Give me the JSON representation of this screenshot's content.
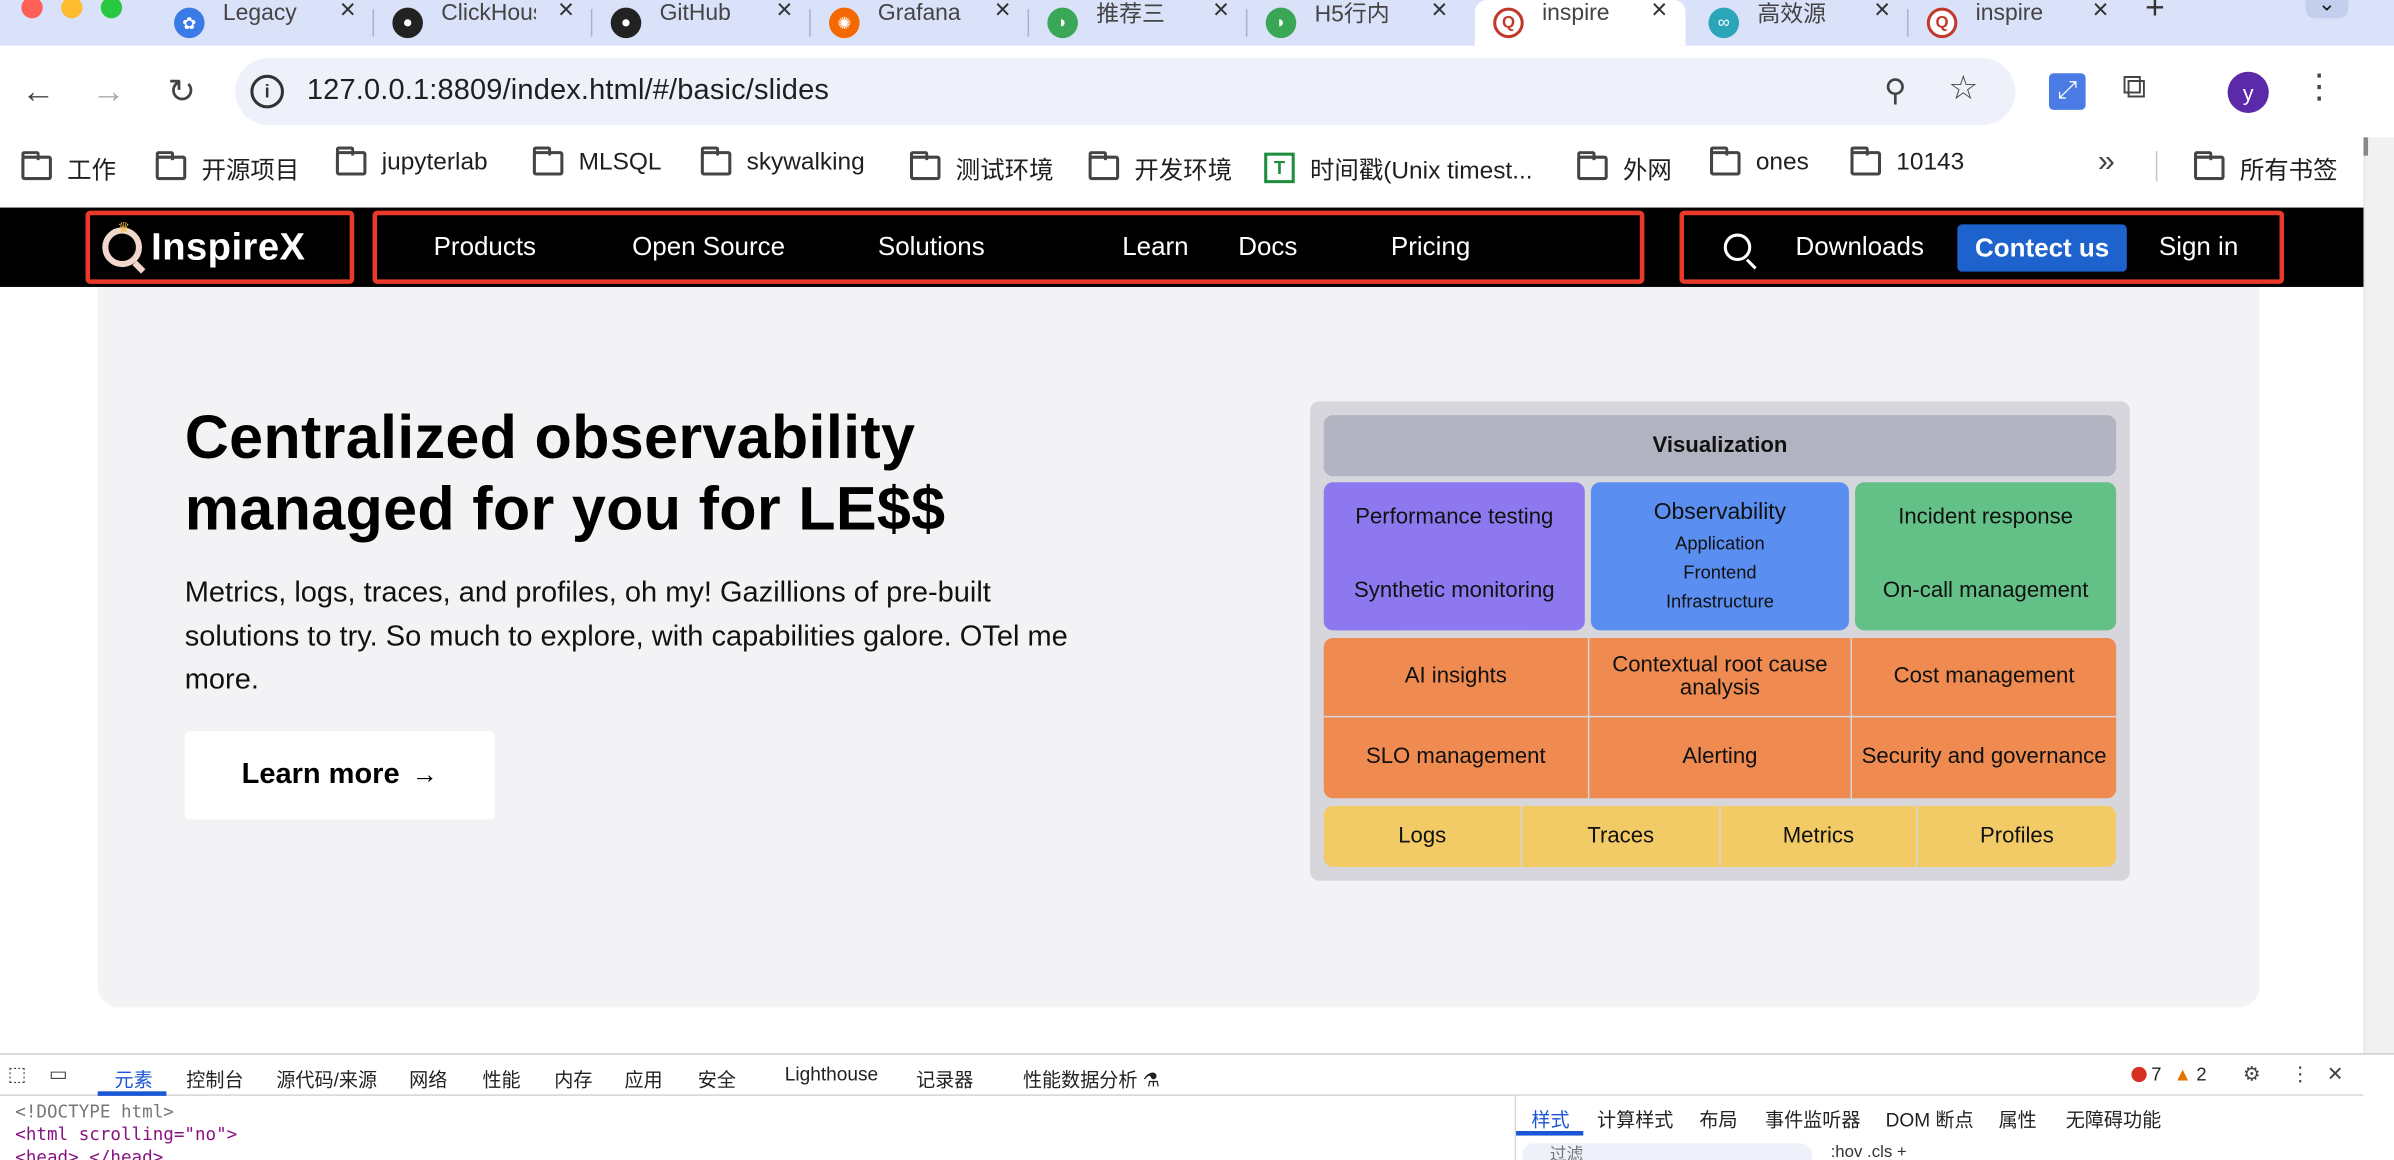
{
  "browser": {
    "tabs": [
      {
        "title": "Legacy",
        "favicon": "legacy-icon",
        "color": "#3b7be5",
        "active": false
      },
      {
        "title": "ClickHouse",
        "favicon": "github-icon",
        "color": "#222222",
        "active": false
      },
      {
        "title": "GitHub",
        "favicon": "github-icon",
        "color": "#222222",
        "active": false
      },
      {
        "title": "Grafana",
        "favicon": "grafana-icon",
        "color": "#f46800",
        "active": false
      },
      {
        "title": "推荐三",
        "favicon": "leaf-icon",
        "color": "#3aa757",
        "active": false
      },
      {
        "title": "H5行内",
        "favicon": "leaf-icon",
        "color": "#3aa757",
        "active": false
      },
      {
        "title": "inspire",
        "favicon": "inspirex-icon",
        "color": "#c0392b",
        "active": true
      },
      {
        "title": "高效源",
        "favicon": "link-icon",
        "color": "#2aa6b8",
        "active": false
      },
      {
        "title": "inspire",
        "favicon": "inspirex-icon",
        "color": "#c0392b",
        "active": false
      }
    ],
    "url": "127.0.0.1:8809/index.html/#/basic/slides",
    "profile_initial": "y",
    "bookmarks": [
      {
        "label": "工作",
        "icon": "folder-icon"
      },
      {
        "label": "开源项目",
        "icon": "folder-icon"
      },
      {
        "label": "jupyterlab",
        "icon": "folder-icon"
      },
      {
        "label": "MLSQL",
        "icon": "folder-icon"
      },
      {
        "label": "skywalking",
        "icon": "folder-icon"
      },
      {
        "label": "测试环境",
        "icon": "folder-icon"
      },
      {
        "label": "开发环境",
        "icon": "folder-icon"
      },
      {
        "label": "时间戳(Unix timest...",
        "icon": "sheet-icon"
      },
      {
        "label": "外网",
        "icon": "folder-icon"
      },
      {
        "label": "ones",
        "icon": "folder-icon"
      },
      {
        "label": "10143",
        "icon": "folder-icon"
      }
    ],
    "bookmarks_more": "»",
    "all_bookmarks": "所有书签"
  },
  "site": {
    "brand": "InspireX",
    "nav": [
      "Products",
      "Open Source",
      "Solutions",
      "Learn",
      "Docs",
      "Pricing"
    ],
    "downloads": "Downloads",
    "contact": "Contect us",
    "signin": "Sign in",
    "highlight_color": "#e8392a"
  },
  "hero": {
    "title": "Centralized observability managed for you for LE$$",
    "description": "Metrics, logs, traces, and profiles, oh my! Gazillions of pre-built solutions to try. So much to explore, with capabilities galore. OTel me more.",
    "cta": "Learn more",
    "cta_arrow": "→"
  },
  "diagram": {
    "visualization": "Visualization",
    "performance_testing": "Performance testing",
    "synthetic_monitoring": "Synthetic monitoring",
    "observability": "Observability",
    "observability_items": [
      "Application",
      "Frontend",
      "Infrastructure"
    ],
    "incident_response": "Incident response",
    "oncall_management": "On-call management",
    "ai_insights": "AI insights",
    "contextual_rca": "Contextual root cause analysis",
    "cost_management": "Cost management",
    "slo_management": "SLO management",
    "alerting": "Alerting",
    "security_governance": "Security and governance",
    "signals": [
      "Logs",
      "Traces",
      "Metrics",
      "Profiles"
    ]
  },
  "devtools": {
    "tabs": [
      "元素",
      "控制台",
      "源代码/来源",
      "网络",
      "性能",
      "内存",
      "应用",
      "安全",
      "Lighthouse",
      "记录器",
      "性能数据分析"
    ],
    "errors": "7",
    "warnings": "2",
    "dom_lines": [
      "<!DOCTYPE html>",
      "<html scrolling=\"no\">",
      "<head>…</head>"
    ],
    "styles_tabs": [
      "样式",
      "计算样式",
      "布局",
      "事件监听器",
      "DOM 断点",
      "属性",
      "无障碍功能"
    ],
    "filter_placeholder": "过滤",
    "style_tools": ":hov  .cls  +"
  }
}
